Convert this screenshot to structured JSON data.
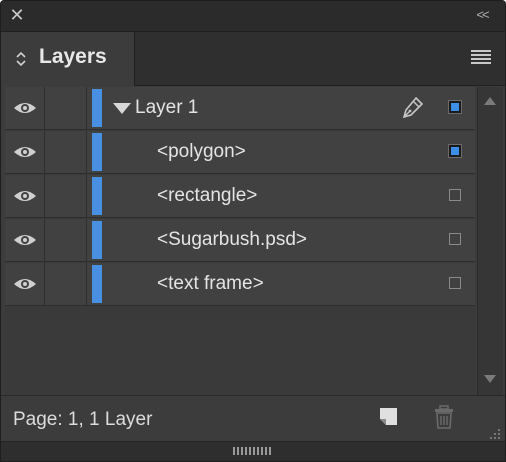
{
  "window": {
    "close_icon": "close-icon",
    "collapse_icon": "double-chevron-left-icon",
    "close_glyph": "✕",
    "collapse_glyph": "<<"
  },
  "tab": {
    "label": "Layers",
    "arrows_icon": "up-down-arrows-icon",
    "menu_icon": "hamburger-menu-icon"
  },
  "layers": [
    {
      "name": "Layer 1",
      "visible": true,
      "expanded": true,
      "is_parent": true,
      "selected": true,
      "target_icon": "pen-icon"
    },
    {
      "name": "<polygon>",
      "visible": true,
      "is_parent": false,
      "selected": true
    },
    {
      "name": "<rectangle>",
      "visible": true,
      "is_parent": false,
      "selected": false
    },
    {
      "name": "<Sugarbush.psd>",
      "visible": true,
      "is_parent": false,
      "selected": false
    },
    {
      "name": "<text frame>",
      "visible": true,
      "is_parent": false,
      "selected": false
    }
  ],
  "colors": {
    "layer_color": "#4a90e2",
    "selection_fill": "#3d8ee6",
    "panel_bg": "#3c3c3c"
  },
  "footer": {
    "status": "Page: 1, 1 Layer",
    "new_layer_icon": "new-layer-icon",
    "delete_icon": "trash-icon",
    "resize_icon": "resize-grip-icon"
  }
}
